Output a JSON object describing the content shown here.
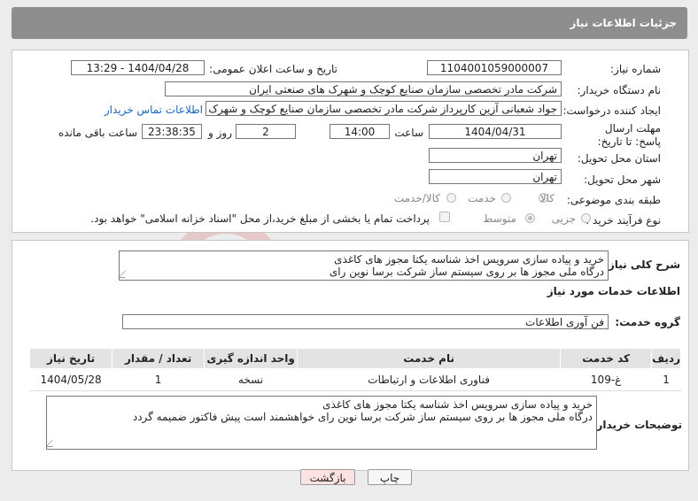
{
  "header": {
    "title": "جزئیات اطلاعات نیاز"
  },
  "form": {
    "need_number_label": "شماره نیاز:",
    "need_number": "1104001059000007",
    "announce_label": "تاریخ و ساعت اعلان عمومی:",
    "announce_value": "1404/04/28 - 13:29",
    "buyer_label": "نام دستگاه خریدار:",
    "buyer_value": "شرکت مادر تخصصی سازمان صنایع کوچک و شهرک های صنعتی ایران",
    "creator_label": "ایجاد کننده درخواست:",
    "creator_value": "جواد  شعبانی آزین کارپرداز  شرکت مادر تخصصی سازمان صنایع کوچک و شهرک",
    "contact_link": "اطلاعات تماس خریدار",
    "deadline_label": "مهلت ارسال پاسخ: تا تاریخ:",
    "deadline_date": "1404/04/31",
    "time_label": "ساعت",
    "deadline_time": "14:00",
    "days_value": "2",
    "days_label": "روز و",
    "remaining_value": "23:38:35",
    "remaining_label": "ساعت باقی مانده",
    "province_label": "استان محل تحویل:",
    "province_value": "تهران",
    "city_label": "شهر محل تحویل:",
    "city_value": "تهران",
    "category_label": "طبقه بندی موضوعی:",
    "category_options": [
      "کالا",
      "خدمت",
      "کالا/خدمت"
    ],
    "process_label": "نوع فرآیند خرید :",
    "process_options": [
      "جزیی",
      "متوسط"
    ],
    "payment_note": "پرداخت تمام یا بخشی از مبلغ خرید،از محل \"اسناد خزانه اسلامی\" خواهد بود."
  },
  "summary": {
    "label": "شرح کلی نیاز:",
    "text_line1": "خرید و پیاده سازی سرویس اخذ شناسه یکتا مجوز های کاغذی",
    "text_line2": "درگاه ملی مجوز ها بر روی سیستم ساز شرکت برسا نوین رای"
  },
  "services": {
    "section_title": "اطلاعات خدمات مورد نیاز",
    "group_label": "گروه خدمت:",
    "group_value": "فن آوری اطلاعات",
    "columns": [
      "ردیف",
      "کد خدمت",
      "نام خدمت",
      "واحد اندازه گیری",
      "تعداد / مقدار",
      "تاریخ نیاز"
    ],
    "rows": [
      [
        "1",
        "غ-109",
        "فناوری اطلاعات و ارتباطات",
        "نسخه",
        "1",
        "1404/05/28"
      ]
    ]
  },
  "buyer_notes": {
    "label": "توضیحات خریدار:",
    "line1": "خرید و پیاده سازی سرویس اخذ شناسه یکتا مجوز های کاغذی",
    "line2": "درگاه ملی مجوز ها بر روی سیستم ساز شرکت برسا نوین رای خواهشمند است پیش فاکتور ضمیمه گردد"
  },
  "buttons": {
    "print": "چاپ",
    "back": "بازگشت"
  },
  "colors": {
    "header_bg": "#8e8e8e",
    "link": "#1565c0",
    "back_button_bg": "#fde2e2",
    "watermark": "#c62828"
  }
}
